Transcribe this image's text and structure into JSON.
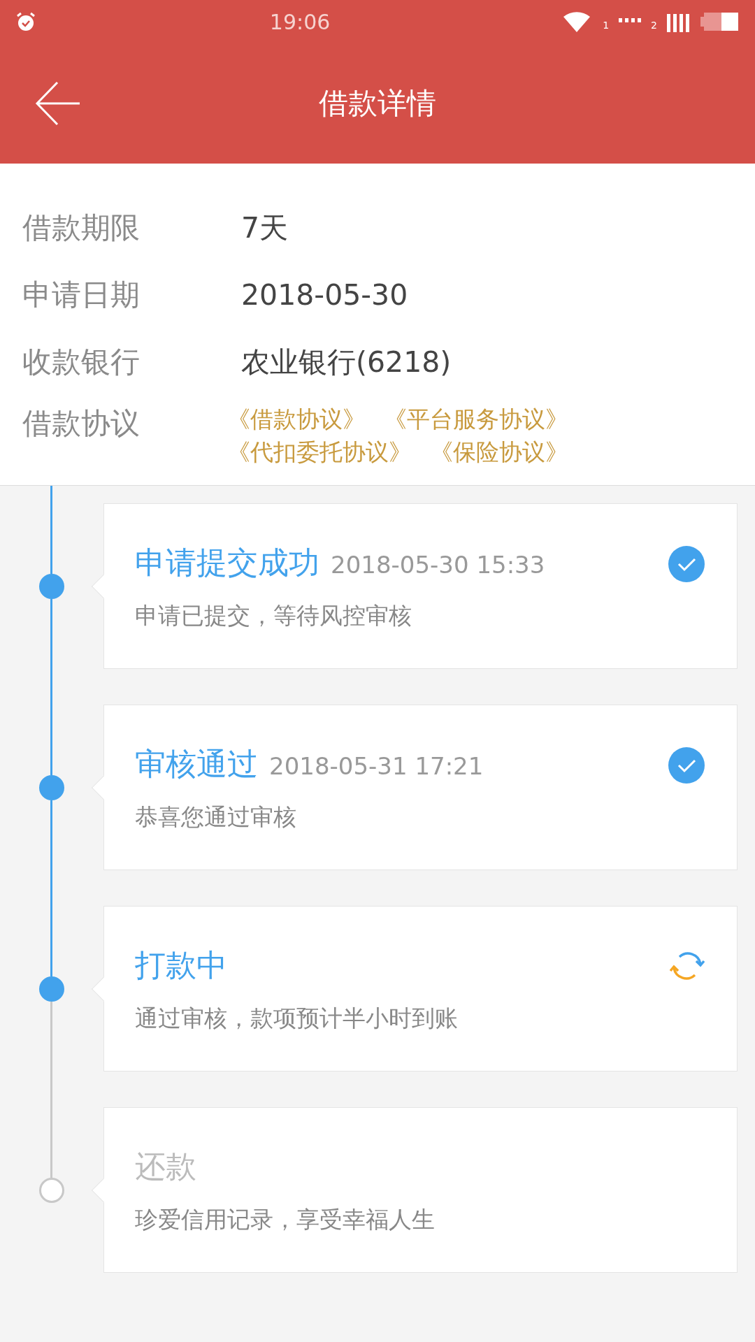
{
  "status_bar": {
    "time": "19:06",
    "sim_1": "1",
    "sim_2": "2"
  },
  "header": {
    "title": "借款详情"
  },
  "details": [
    {
      "label": "借款期限",
      "value": "7天",
      "kind": "text"
    },
    {
      "label": "申请日期",
      "value": "2018-05-30",
      "kind": "text"
    },
    {
      "label": "收款银行",
      "value": "农业银行(6218)",
      "kind": "text"
    },
    {
      "label": "借款协议",
      "kind": "links",
      "links": [
        "《借款协议》",
        "《平台服务协议》",
        "《代扣委托协议》",
        "《保险协议》"
      ]
    }
  ],
  "steps": [
    {
      "title": "申请提交成功",
      "time": "2018-05-30 15:33",
      "description": "申请已提交，等待风控审核",
      "kind": "done"
    },
    {
      "title": "审核通过",
      "time": "2018-05-31 17:21",
      "description": "恭喜您通过审核",
      "kind": "done"
    },
    {
      "title": "打款中",
      "description": "通过审核，款项预计半小时到账",
      "kind": "processing"
    },
    {
      "title": "还款",
      "description": "珍爱信用记录，享受幸福人生",
      "kind": "pending"
    }
  ]
}
